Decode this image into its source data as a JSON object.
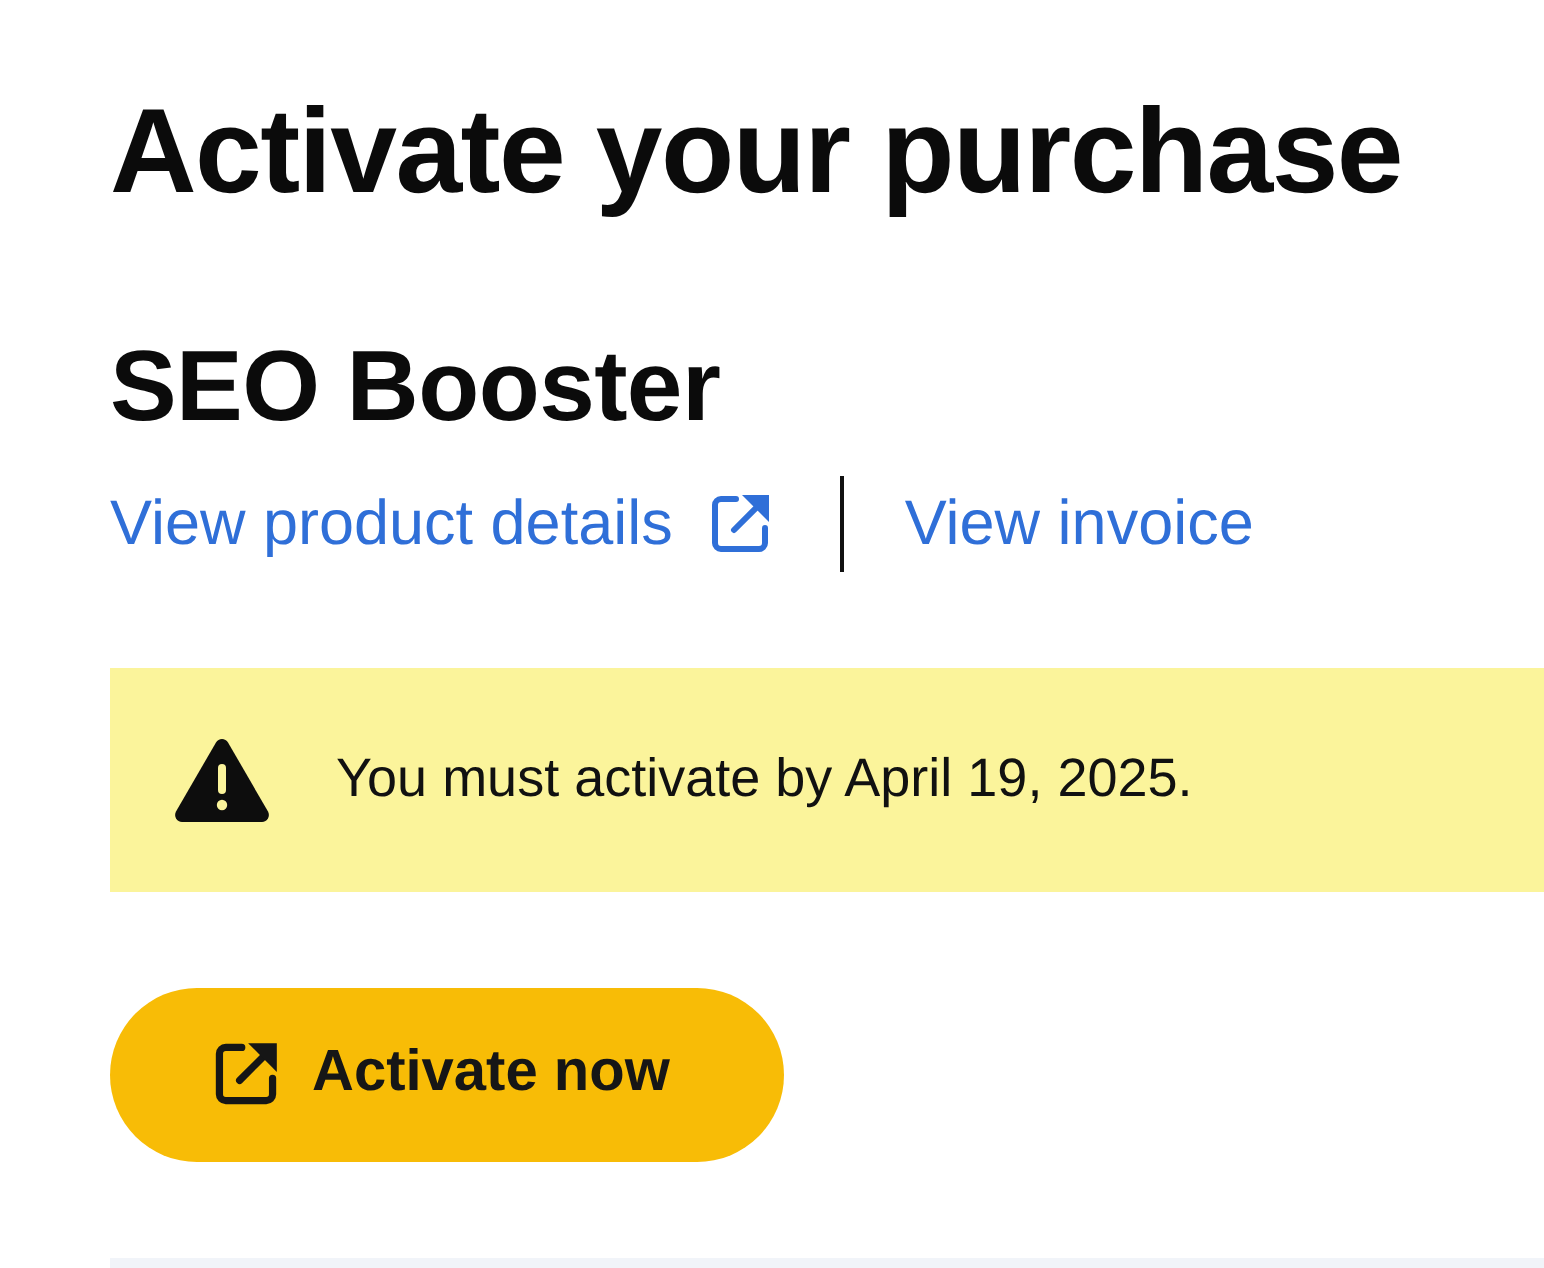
{
  "heading": "Activate your purchase",
  "product": {
    "name": "SEO Booster",
    "links": [
      {
        "label": "View product details",
        "external": true
      },
      {
        "label": "View invoice",
        "external": false
      }
    ]
  },
  "alert": {
    "kind": "warning",
    "message": "You must activate by April 19, 2025."
  },
  "primary_button": {
    "label": "Activate now",
    "external": true
  }
}
